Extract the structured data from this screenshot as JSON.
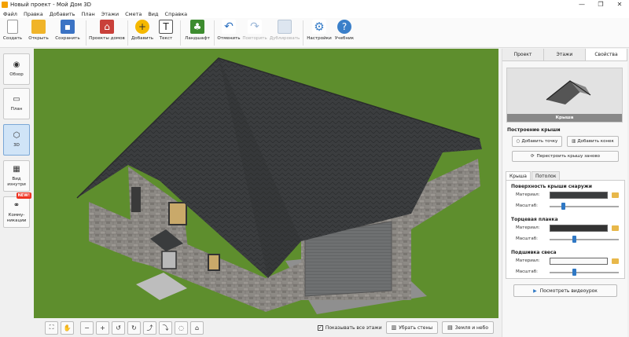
{
  "titlebar": {
    "title": "Новый проект - Мой Дом 3D",
    "min": "—",
    "max": "❐",
    "close": "✕"
  },
  "menu": [
    "Файл",
    "Правка",
    "Добавить",
    "План",
    "Этажи",
    "Смета",
    "Вид",
    "Справка"
  ],
  "toolbar": {
    "create": "Создать",
    "open": "Открыть",
    "save": "Сохранить",
    "projects": "Проекты домов",
    "add": "Добавить",
    "text": "Текст",
    "landscape": "Ландшафт",
    "undo": "Отменить",
    "redo": "Повторить",
    "duplicate": "Дублировать",
    "settings": "Настройки",
    "tutorial": "Учебник"
  },
  "leftbar": {
    "overview": "Обзор",
    "plan": "План",
    "view3d": "3D",
    "views": "Вид изнутри",
    "comm": "Комму-никации",
    "new_badge": "NEW!"
  },
  "bottombar": {
    "show_all_floors": "Показывать все этажи",
    "remove_walls": "Убрать стены",
    "ground_sky": "Земля и небо"
  },
  "panel": {
    "tabs": [
      "Проект",
      "Этажи",
      "Свойства"
    ],
    "preview_caption": "Крыша",
    "build_title": "Построение крыши",
    "add_point": "Добавить точку",
    "add_ridge": "Добавить конек",
    "rebuild": "Перестроить крышу заново",
    "subtabs": [
      "Крыша",
      "Потолок"
    ],
    "surface_title": "Поверхность крыши снаружи",
    "fascia_title": "Торцевая планка",
    "soffit_title": "Подшивка свеса",
    "material_label": "Материал:",
    "scale_label": "Масштаб:",
    "scales": [
      0.18,
      0.35,
      0.35
    ],
    "video": "Посмотреть видеоурок"
  },
  "colors": {
    "grass": "#5e8e2d",
    "roof": "#3a3c3d",
    "wall": "#8e8b86",
    "door": "#707273"
  }
}
